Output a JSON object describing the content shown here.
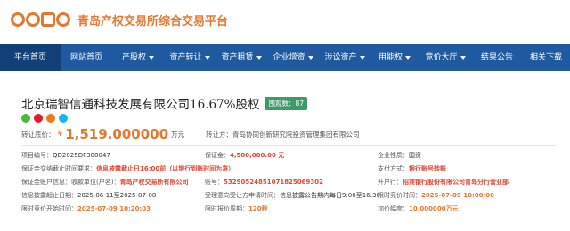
{
  "site": {
    "logo_letters": [
      "Q",
      "D",
      "D",
      "Q"
    ],
    "name": "青岛产权交易所综合交易平台"
  },
  "nav": [
    {
      "label": "平台首页",
      "active": true,
      "dropdown": false,
      "width": 68
    },
    {
      "label": "网站首页",
      "active": false,
      "dropdown": false,
      "width": 58
    },
    {
      "label": "产股权",
      "active": false,
      "dropdown": true,
      "width": 58
    },
    {
      "label": "资产转让",
      "active": false,
      "dropdown": true,
      "width": 58
    },
    {
      "label": "资产租赁",
      "active": false,
      "dropdown": true,
      "width": 58
    },
    {
      "label": "企业增资",
      "active": false,
      "dropdown": true,
      "width": 58
    },
    {
      "label": "涉讼资产",
      "active": false,
      "dropdown": true,
      "width": 58
    },
    {
      "label": "用能权",
      "active": false,
      "dropdown": true,
      "width": 54
    },
    {
      "label": "竞价大厅",
      "active": false,
      "dropdown": true,
      "width": 60
    },
    {
      "label": "结果公告",
      "active": false,
      "dropdown": false,
      "width": 56
    },
    {
      "label": "相关下载",
      "active": false,
      "dropdown": false,
      "width": 54
    }
  ],
  "listing": {
    "title": "北京瑞智信通科技发展有限公司16.67%股权",
    "views": "围观数：87",
    "price_label": "转让底价：",
    "currency": "¥",
    "price": "1,519.000000",
    "price_unit": "万元",
    "trustee": "转让方：青岛协同创新研究院投资管理集团有限公司"
  },
  "info": [
    [
      {
        "label": "项目编号：",
        "value": "QD2025DF300047",
        "style": ""
      },
      {
        "label": "保证金：",
        "value": "4,500,000.00",
        "suffix": " 元",
        "style": "red"
      },
      {
        "label": "企业性质：",
        "value": "国资",
        "style": ""
      }
    ],
    [
      {
        "label": "保证金交纳截止时间要求：",
        "value": "信息披露截止日16:00前（以银行到账时间为准）",
        "style": "red"
      },
      {
        "label": "",
        "value": "",
        "style": ""
      },
      {
        "label": "支付方式：",
        "value": "银行账号转账",
        "style": "red"
      }
    ],
    [
      {
        "label": "保证金账户信息：收款单位(户名)：",
        "value": "青岛产权交易所有限公司",
        "style": "red"
      },
      {
        "label": "账号：",
        "value": "532905248510718250693",
        "suffix": "02",
        "style": "red"
      },
      {
        "label": "开户行：",
        "value": "招商银行股份有限公司青岛分行营业部",
        "style": "red"
      }
    ],
    [
      {
        "label": "信息披露起止日期：",
        "value": "2025-06-11至2025-07-08",
        "style": ""
      },
      {
        "label": "受理意向受让方申请时间：",
        "value": "信息披露公告期内每日9:00至16:30",
        "style": ""
      },
      {
        "label": "限时竞价时间：",
        "value": "2025-07-09 10:00:00",
        "style": "orange"
      }
    ],
    [
      {
        "label": "限时竞价开始时间：",
        "value": "2025-07-09 10:20:03",
        "style": "orange"
      },
      {
        "label": "限时报价周期：",
        "value": "120秒",
        "style": "orange"
      },
      {
        "label": "加价幅度：",
        "value": "10.000000万元",
        "style": "orange"
      }
    ]
  ]
}
